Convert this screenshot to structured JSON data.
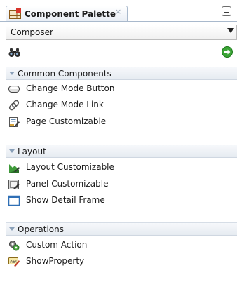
{
  "tab": {
    "title": "Component Palette",
    "close_symbol": "×",
    "icon": "palette-grid-icon"
  },
  "dropdown": {
    "selected": "Composer"
  },
  "toolbar": {
    "search_icon": "binoculars-icon",
    "go_icon": "green-arrow-icon"
  },
  "sections": {
    "common": {
      "label": "Common Components",
      "items": [
        {
          "label": "Change Mode Button",
          "icon": "button-icon"
        },
        {
          "label": "Change Mode Link",
          "icon": "link-chain-icon"
        },
        {
          "label": "Page Customizable",
          "icon": "page-customizable-icon"
        }
      ]
    },
    "layout": {
      "label": "Layout",
      "items": [
        {
          "label": "Layout Customizable",
          "icon": "layout-customizable-icon"
        },
        {
          "label": "Panel Customizable",
          "icon": "panel-customizable-icon"
        },
        {
          "label": "Show Detail Frame",
          "icon": "frame-icon"
        }
      ]
    },
    "operations": {
      "label": "Operations",
      "items": [
        {
          "label": "Custom Action",
          "icon": "gears-icon"
        },
        {
          "label": "ShowProperty",
          "icon": "property-icon"
        }
      ]
    }
  },
  "colors": {
    "tab_border": "#a9b9cc",
    "section_bg": "#e6ebf1",
    "chevron": "#8aa0b8",
    "go_green": "#3aa435"
  }
}
